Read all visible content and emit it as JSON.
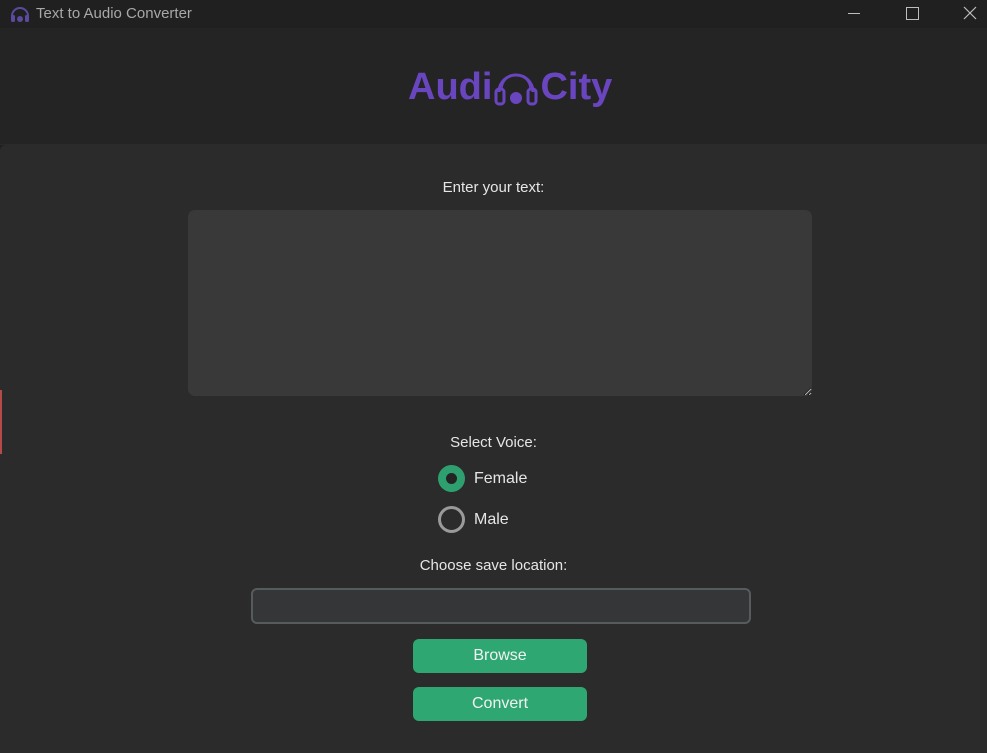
{
  "window": {
    "title": "Text to Audio Converter",
    "app_icon": "headphones-icon",
    "controls": [
      "minimize-icon",
      "maximize-icon",
      "close-icon"
    ]
  },
  "logo": {
    "part1": "Audi",
    "part2": "City",
    "icon": "headphones-icon",
    "color": "#6a45c0"
  },
  "form": {
    "text_label": "Enter your text:",
    "text_value": "",
    "voice_label": "Select Voice:",
    "voice_options": [
      {
        "label": "Female",
        "checked": true
      },
      {
        "label": "Male",
        "checked": false
      }
    ],
    "save_label": "Choose save location:",
    "save_value": "",
    "browse_label": "Browse",
    "convert_label": "Convert"
  },
  "colors": {
    "accent": "#2ea772",
    "logo": "#6a45c0",
    "background": "#2b2b2b"
  }
}
